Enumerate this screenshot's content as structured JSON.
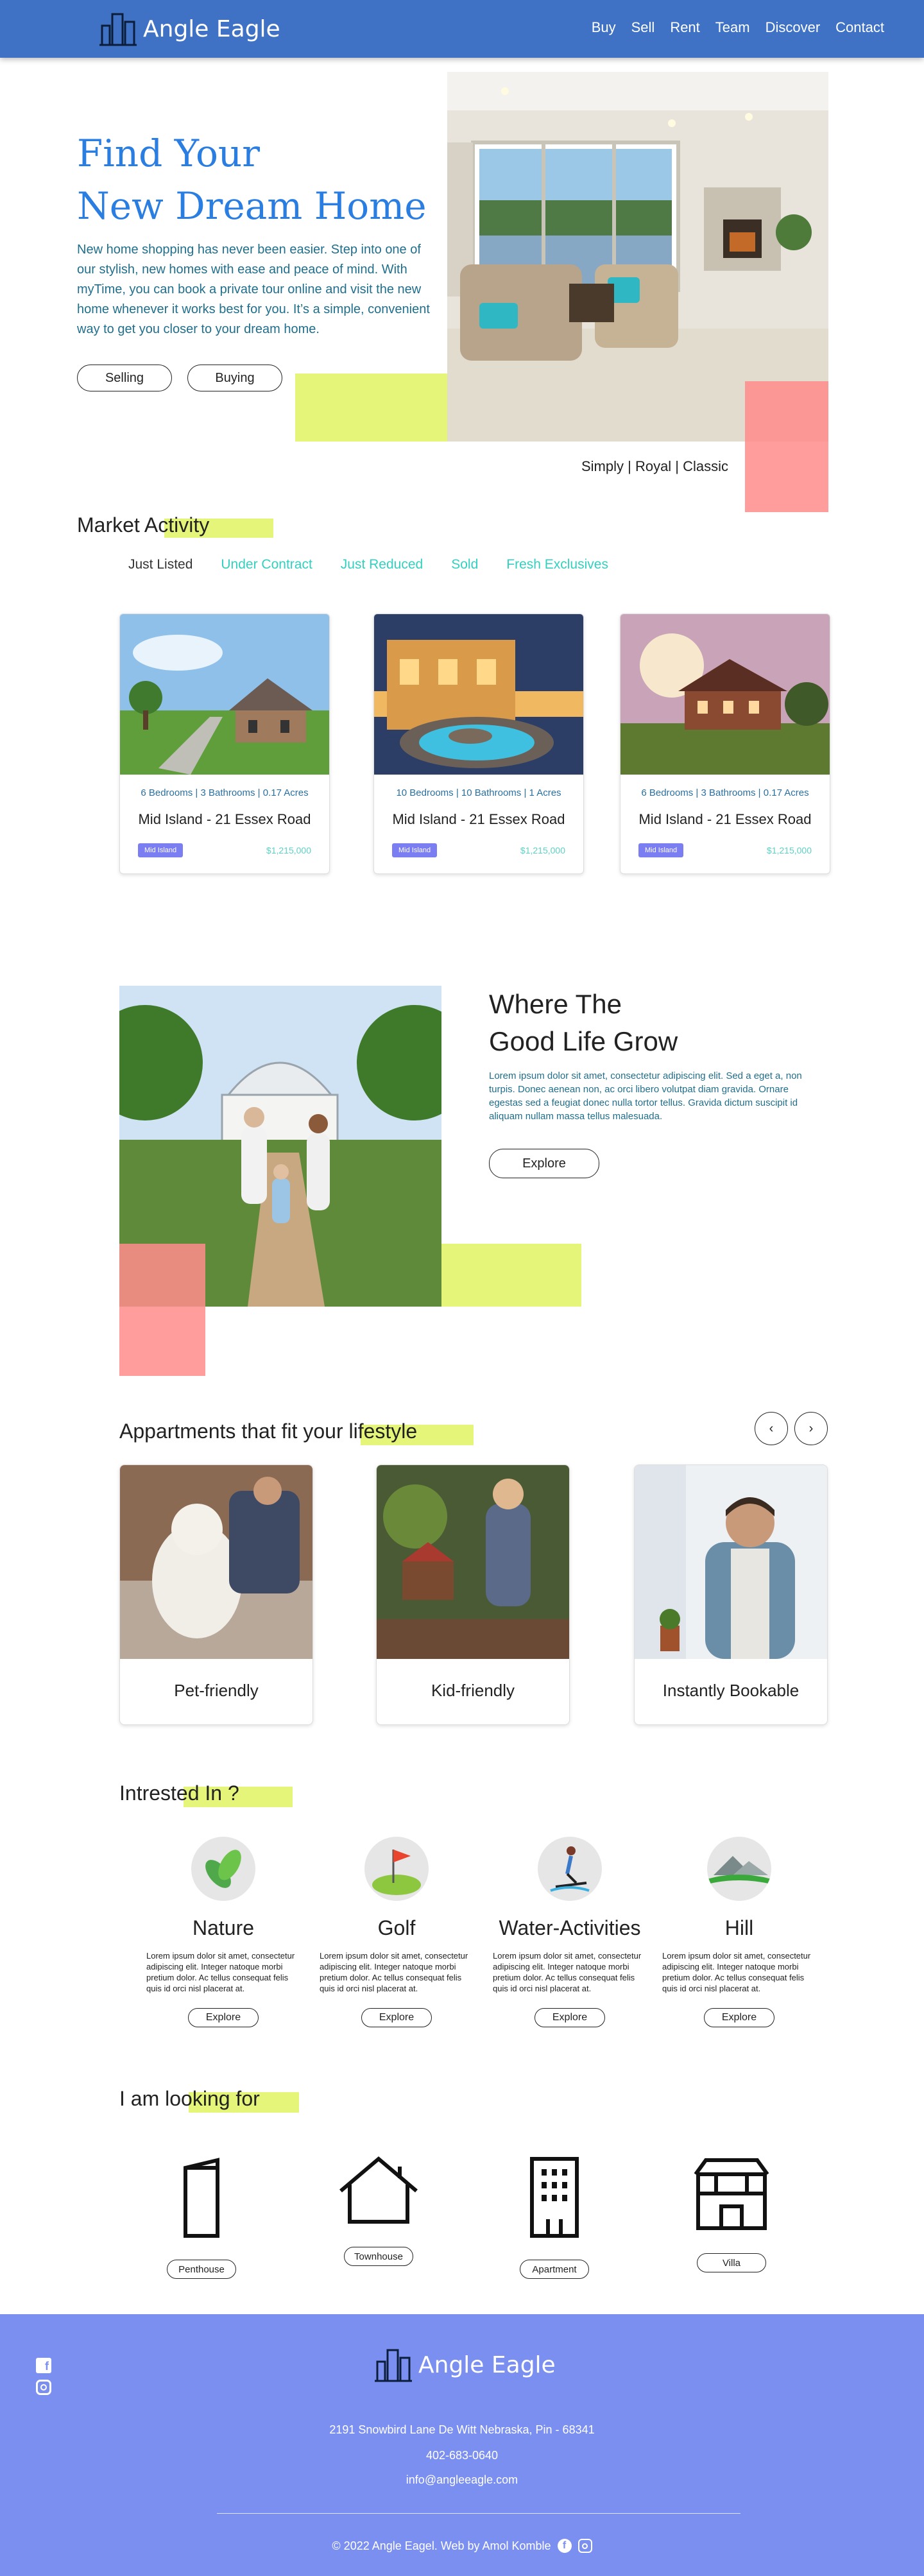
{
  "header": {
    "logo_text": "Angle Eagle",
    "nav": [
      "Buy",
      "Sell",
      "Rent",
      "Team",
      "Discover",
      "Contact"
    ]
  },
  "hero": {
    "title_line1": "Find Your",
    "title_line2": "New Dream Home",
    "description": "New home shopping has never been easier. Step into one of our stylish, new homes with ease and peace of mind. With myTime, you can book a private tour online and visit the new home whenever it works best for you. It’s a simple, convenient way to get you closer to your dream home.",
    "btn_selling": "Selling",
    "btn_buying": "Buying",
    "tagline": "Simply | Royal | Classic"
  },
  "market": {
    "heading": "Market Activity",
    "tabs": [
      "Just Listed",
      "Under Contract",
      "Just Reduced",
      "Sold",
      "Fresh Exclusives"
    ],
    "cards": [
      {
        "meta": "6 Bedrooms | 3 Bathrooms | 0.17 Acres",
        "title": "Mid Island - 21 Essex Road",
        "badge": "Mid Island",
        "price": "$1,215,000"
      },
      {
        "meta": "10 Bedrooms | 10 Bathrooms | 1 Acres",
        "title": "Mid Island - 21 Essex Road",
        "badge": "Mid Island",
        "price": "$1,215,000"
      },
      {
        "meta": "6 Bedrooms | 3 Bathrooms | 0.17 Acres",
        "title": "Mid Island - 21 Essex Road",
        "badge": "Mid Island",
        "price": "$1,215,000"
      }
    ]
  },
  "goodlife": {
    "title_line1": "Where  The",
    "title_line2": "Good Life Grow",
    "description": "Lorem ipsum dolor sit amet, consectetur adipiscing elit. Sed a eget a, non turpis. Donec aenean non, ac orci libero volutpat diam gravida. Ornare egestas sed a feugiat donec nulla tortor tellus. Gravida dictum suscipit id aliquam nullam massa tellus malesuada.",
    "button": "Explore"
  },
  "apartments": {
    "heading": "Appartments that fit your lifestyle",
    "prev": "‹",
    "next": "›",
    "items": [
      "Pet-friendly",
      "Kid-friendly",
      "Instantly Bookable"
    ]
  },
  "interests": {
    "heading": "Intrested In ?",
    "items": [
      {
        "name": "Nature",
        "text": "Lorem ipsum dolor sit amet, consectetur adipiscing elit. Integer natoque morbi pretium dolor. Ac tellus consequat felis quis id orci nisl placerat at.",
        "button": "Explore"
      },
      {
        "name": "Golf",
        "text": "Lorem ipsum dolor sit amet, consectetur adipiscing elit. Integer natoque morbi pretium dolor. Ac tellus consequat felis quis id orci nisl placerat at.",
        "button": "Explore"
      },
      {
        "name": "Water-Activities",
        "text": "Lorem ipsum dolor sit amet, consectetur adipiscing elit. Integer natoque morbi pretium dolor. Ac tellus consequat felis quis id orci nisl placerat at.",
        "button": "Explore"
      },
      {
        "name": "Hill",
        "text": "Lorem ipsum dolor sit amet, consectetur adipiscing elit. Integer natoque morbi pretium dolor. Ac tellus consequat felis quis id orci nisl placerat at.",
        "button": "Explore"
      }
    ]
  },
  "looking": {
    "heading": "I am looking for",
    "items": [
      "Penthouse",
      "Townhouse",
      "Apartment",
      "Villa"
    ]
  },
  "footer": {
    "logo_text": "Angle Eagle",
    "address": "2191 Snowbird Lane De Witt Nebraska, Pin - 68341",
    "phone": "402-683-0640",
    "email": "info@angleeagle.com",
    "copyright": "© 2022 Angle Eagel. Web by Amol Komble"
  },
  "colors": {
    "header": "#3f72c4",
    "accent_blue": "#2a7de1",
    "lime": "#e4f57a",
    "pink": "#ff9e9e",
    "teal": "#33d0c0",
    "footer": "#7b8ff0"
  }
}
